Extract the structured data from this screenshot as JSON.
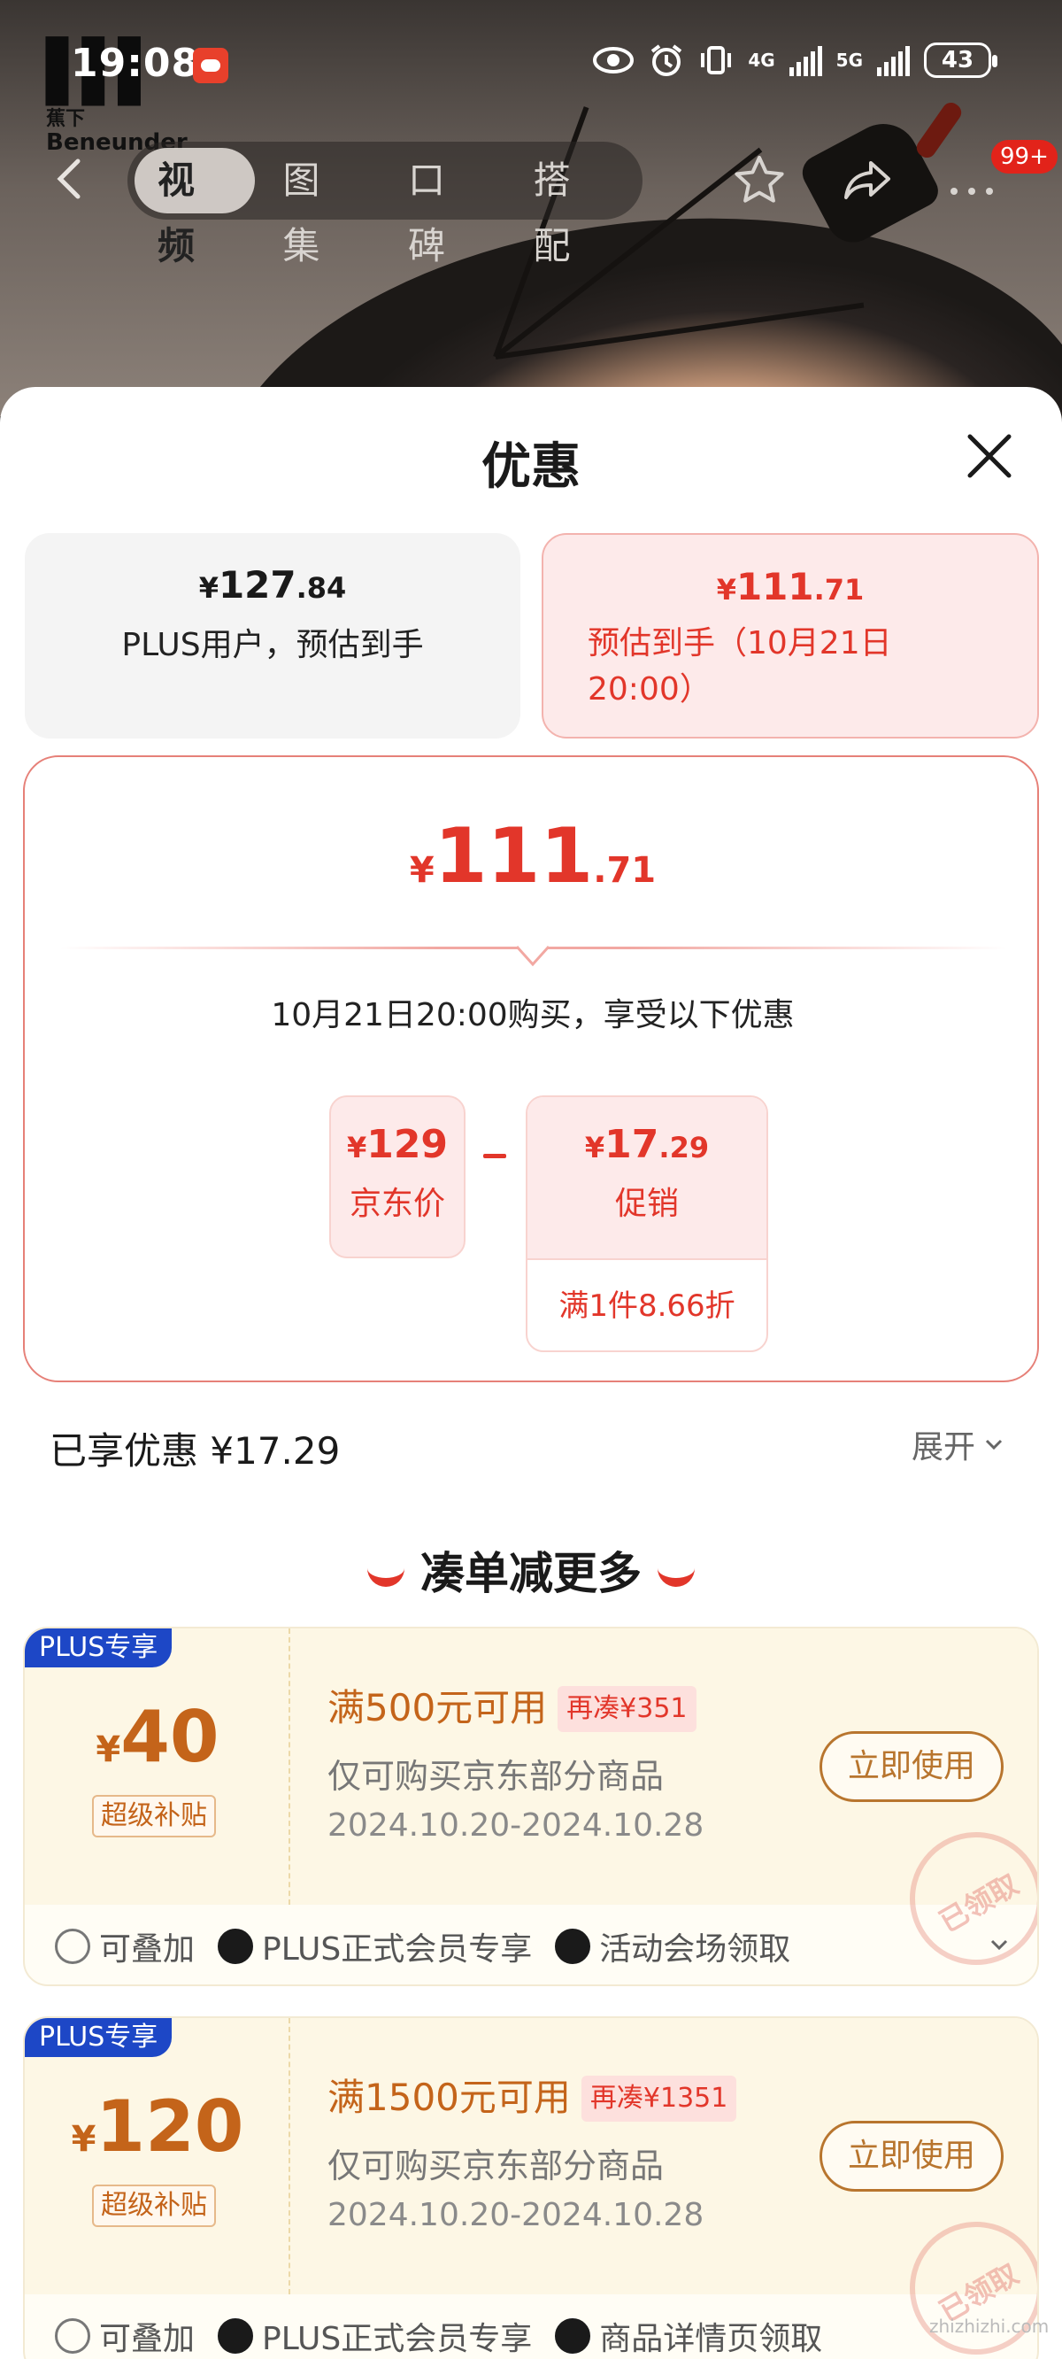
{
  "status": {
    "time": "19:08",
    "net1": "4G",
    "net2": "5G",
    "battery": "43"
  },
  "brand": {
    "line1": "蕉下",
    "line2": "Beneunder"
  },
  "nav": {
    "tabs": [
      {
        "label": "视频",
        "active": true
      },
      {
        "label": "图集"
      },
      {
        "label": "口碑"
      },
      {
        "label": "搭配"
      }
    ],
    "badge": "99+"
  },
  "sheet": {
    "title": "优惠",
    "options": [
      {
        "price_int": "127",
        "price_dec": ".84",
        "symbol": "¥",
        "label": "PLUS用户，预估到手"
      },
      {
        "price_int": "111",
        "price_dec": ".71",
        "symbol": "¥",
        "label": "预估到手（10月21日20:00）"
      }
    ],
    "detail": {
      "symbol": "¥",
      "price_int": "111",
      "price_dec": ".71",
      "note": "10月21日20:00购买，享受以下优惠",
      "jd_price": {
        "symbol": "¥",
        "value": "129",
        "label": "京东价"
      },
      "promo": {
        "symbol": "¥",
        "value": "17",
        "dec": ".29",
        "label": "促销",
        "sub": "满1件8.66折"
      }
    },
    "enjoyed": "已享优惠 ¥17.29",
    "expand": "展开",
    "more_title": "凑单减更多",
    "coupons": [
      {
        "tag": "PLUS专享",
        "symbol": "¥",
        "amount": "40",
        "sub": "超级补贴",
        "condition": "满500元可用",
        "extra": "再凑¥351",
        "scope": "仅可购买京东部分商品",
        "date": "2024.10.20-2024.10.28",
        "button": "立即使用",
        "stamp": "已领取",
        "features": [
          "可叠加",
          "PLUS正式会员专享",
          "活动会场领取"
        ]
      },
      {
        "tag": "PLUS专享",
        "symbol": "¥",
        "amount": "120",
        "sub": "超级补贴",
        "condition": "满1500元可用",
        "extra": "再凑¥1351",
        "scope": "仅可购买京东部分商品",
        "date": "2024.10.20-2024.10.28",
        "button": "立即使用",
        "stamp": "已领取",
        "features": [
          "可叠加",
          "PLUS正式会员专享",
          "商品详情页领取"
        ]
      }
    ]
  },
  "watermark": "zhizhizhi.com"
}
